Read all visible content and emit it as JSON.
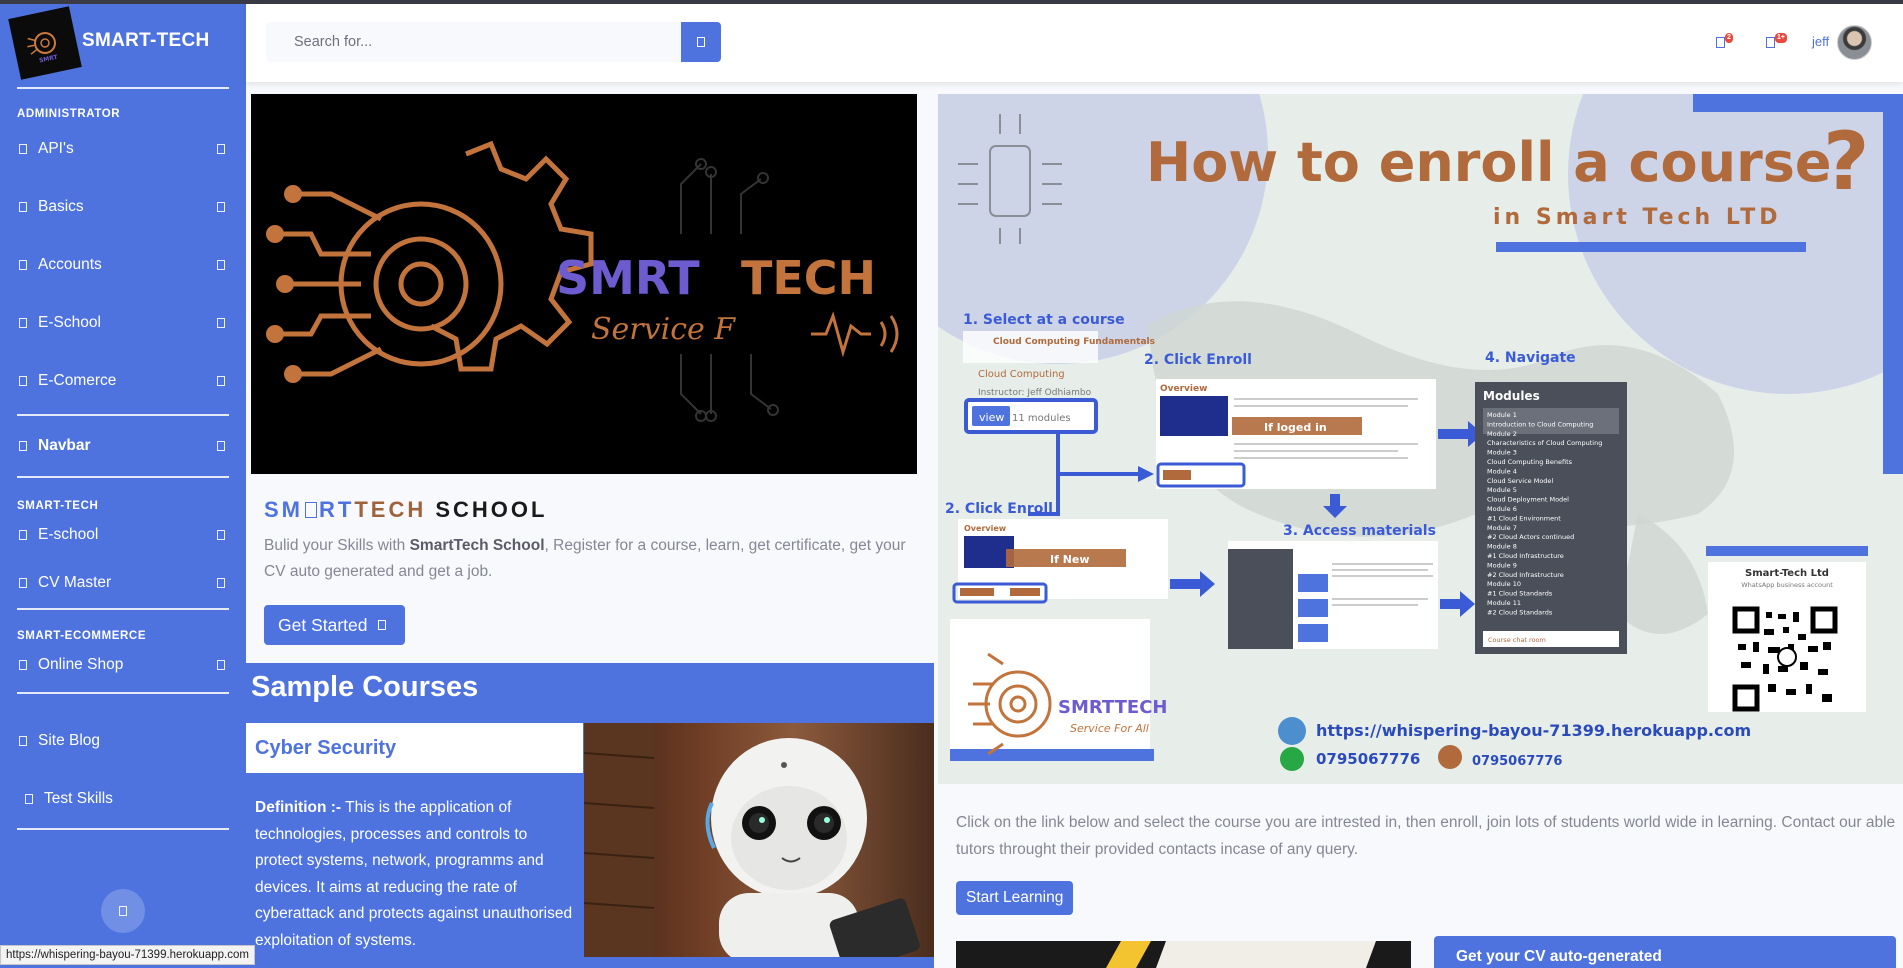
{
  "brand": {
    "name": "SMART-TECH"
  },
  "sidebar": {
    "headings": [
      "ADMINISTRATOR",
      "SMART-TECH",
      "SMART-ECOMMERCE"
    ],
    "items": [
      {
        "label": "API's"
      },
      {
        "label": "Basics"
      },
      {
        "label": "Accounts"
      },
      {
        "label": "E-School"
      },
      {
        "label": "E-Comerce"
      },
      {
        "label": "Navbar"
      },
      {
        "label": "E-school"
      },
      {
        "label": "CV Master"
      },
      {
        "label": "Online Shop"
      },
      {
        "label": "Site Blog"
      },
      {
        "label": "Test Skills"
      }
    ]
  },
  "topbar": {
    "search_placeholder": "Search for...",
    "alerts_badge": "2",
    "messages_badge": "1+",
    "user_name": "jeff"
  },
  "hero": {
    "title_part1": "SM",
    "title_part2": "RT",
    "title_part3": "TECH",
    "title_part4": " SCHOOL",
    "desc_pre": "Bulid your Skills with ",
    "desc_bold": "SmartTech School",
    "desc_post": ", Register for a course, learn, get certificate, get your CV auto generated and get a job.",
    "button": "Get Started",
    "image_text": {
      "smart": "SMRT",
      "tech": "TECH",
      "tagline": "Service F"
    }
  },
  "sample_courses": {
    "title": "Sample Courses",
    "course_name": "Cyber Security",
    "def_label": "Definition :-",
    "def_text": " This is the application of technologies, processes and controls to protect systems, network, programms and devices. It aims at reducing the rate of cyberattack and protects against unauthorised exploitation of systems."
  },
  "infographic": {
    "title": "How to enroll a course",
    "subtitle": "in Smart Tech LTD",
    "qmark": "?",
    "step1": "1. Select at a course",
    "course_name": "Cloud Computing Fundamentals",
    "course_sub": "Cloud Computing",
    "instructor": "Instructor: Jeff Odhiambo",
    "view": "view",
    "modules_count": "11 modules",
    "step2a": "2. Click Enroll",
    "step2b": "2. Click Enroll",
    "overview": "Overview",
    "if_logged": "If loged in",
    "if_new": "If New",
    "step3": "3. Access materials",
    "step4": "4. Navigate",
    "modules_title": "Modules",
    "module_list": [
      "Module 1",
      "Introduction to Cloud Computing",
      "Module 2",
      "Characteristics of Cloud Computing",
      "Module 3",
      "Cloud Computing Benefits",
      "Module 4",
      "Cloud Service Model",
      "Module 5",
      "Cloud Deployment Model",
      "Module 6",
      "#1 Cloud Environment",
      "Module 7",
      "#2 Cloud Actors continued",
      "Module 8",
      "#1 Cloud Infrastructure",
      "Module 9",
      "#2 Cloud Infrastructure",
      "Module 10",
      "#1 Cloud Standards",
      "Module 11",
      "#2 Cloud Standards"
    ],
    "course_chat": "Course chat room",
    "company": "Smart-Tech Ltd",
    "whatsapp_account": "WhatsApp business account",
    "url": "https://whispering-bayou-71399.herokuapp.com",
    "phone1": "0795067776",
    "phone2": "0795067776",
    "logo_smart": "SMRTTECH",
    "logo_tagline": "Service For All"
  },
  "right": {
    "desc": "Click on the link below and select the course you are intrested in, then enroll, join lots of students world wide in learning. Contact our able tutors throught their provided contacts incase of any query.",
    "button": "Start Learning",
    "cv_card_title": "Get your CV auto-generated"
  },
  "statusbar": {
    "url": "https://whispering-bayou-71399.herokuapp.com"
  },
  "colors": {
    "primary": "#4e73df",
    "danger": "#e74a3b",
    "brown": "#b06a3b"
  }
}
